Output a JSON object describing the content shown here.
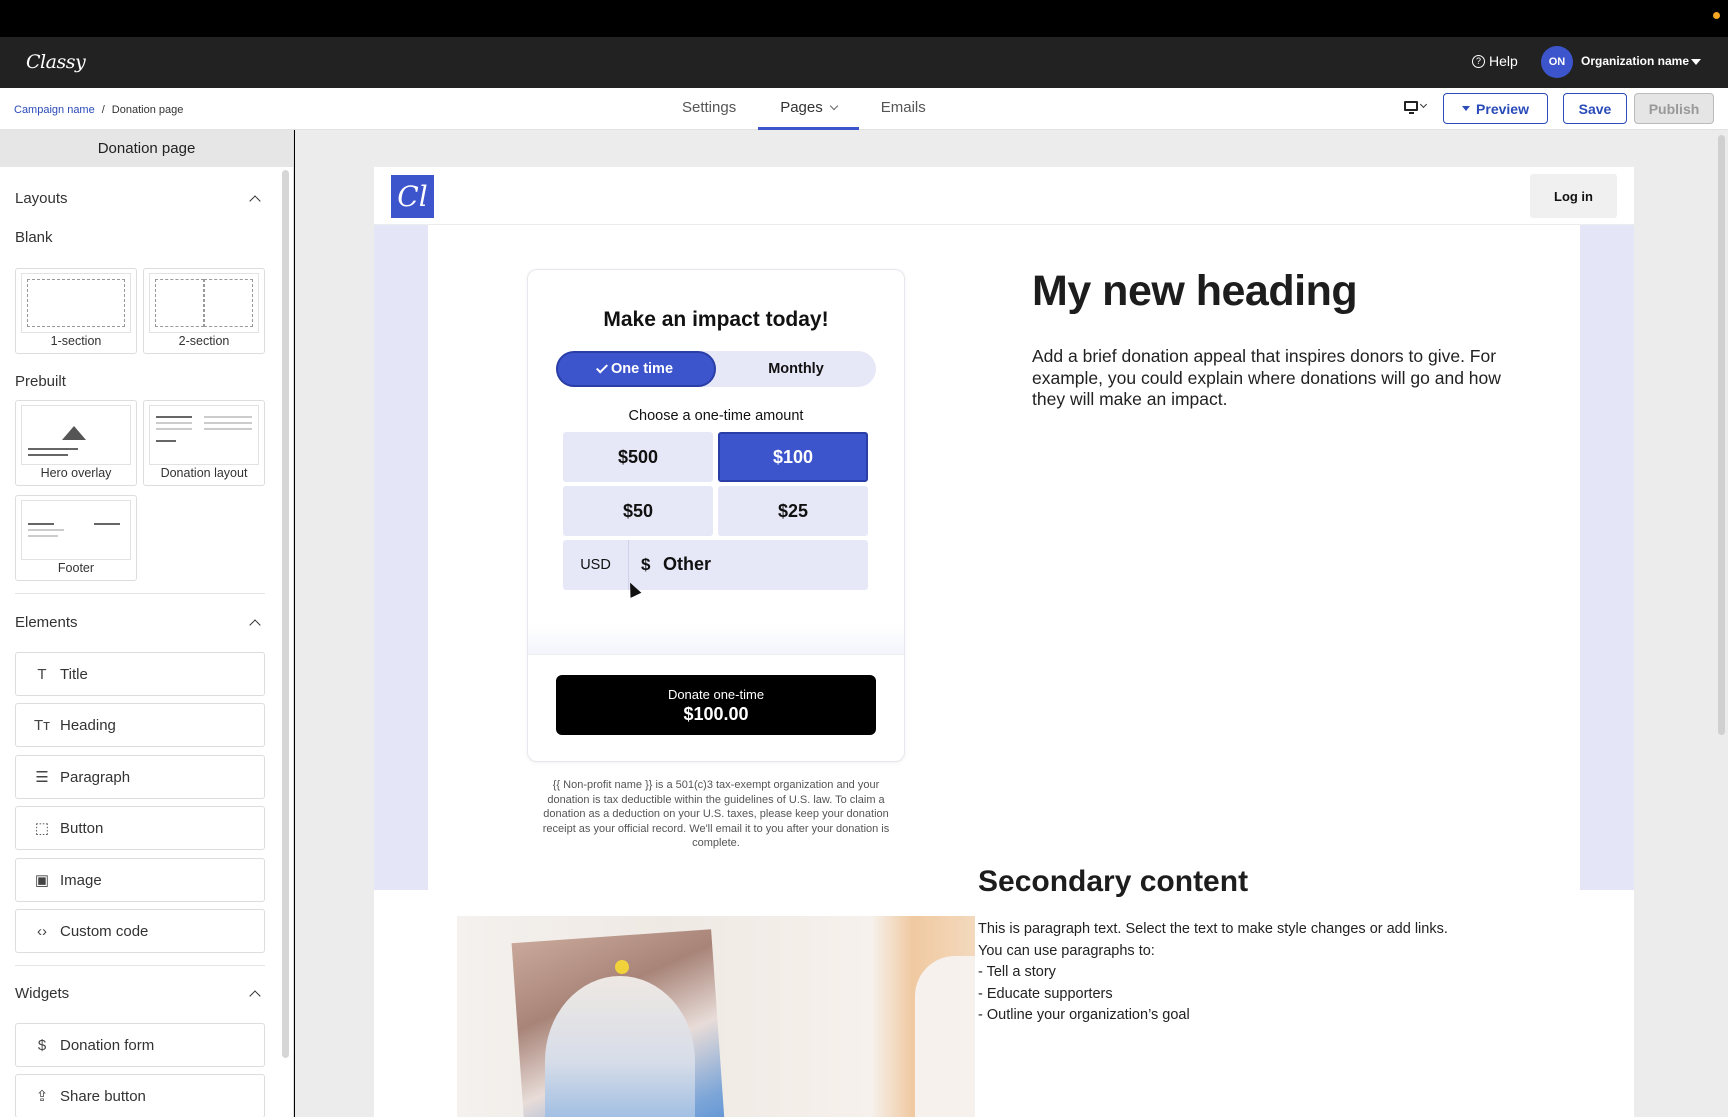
{
  "appbar": {
    "logo": "Classy",
    "help": "Help",
    "avatar_initials": "ON",
    "org_name": "Organization name"
  },
  "breadcrumb": {
    "campaign": "Campaign name",
    "separator": "/",
    "page": "Donation page"
  },
  "tabs": [
    {
      "label": "Settings"
    },
    {
      "label": "Pages"
    },
    {
      "label": "Emails"
    }
  ],
  "actions": {
    "preview": "Preview",
    "save": "Save",
    "publish": "Publish"
  },
  "sidebar": {
    "title": "Donation page",
    "layouts": {
      "title": "Layouts",
      "blank": "Blank",
      "blank_items": [
        "1-section",
        "2-section"
      ],
      "prebuilt": "Prebuilt",
      "prebuilt_items": [
        "Hero overlay",
        "Donation layout",
        "Footer"
      ]
    },
    "elements": {
      "title": "Elements",
      "items": [
        {
          "label": "Title",
          "icon": "title-icon"
        },
        {
          "label": "Heading",
          "icon": "heading-icon"
        },
        {
          "label": "Paragraph",
          "icon": "paragraph-icon"
        },
        {
          "label": "Button",
          "icon": "button-icon"
        },
        {
          "label": "Image",
          "icon": "image-icon"
        },
        {
          "label": "Custom code",
          "icon": "code-icon"
        }
      ]
    },
    "widgets": {
      "title": "Widgets",
      "items": [
        {
          "label": "Donation form",
          "icon": "donation-form-icon"
        },
        {
          "label": "Share button",
          "icon": "share-icon"
        }
      ]
    }
  },
  "page": {
    "logo": "Cl",
    "login": "Log in",
    "form": {
      "title": "Make an impact today!",
      "frequency": [
        "One time",
        "Monthly"
      ],
      "selected_frequency": "One time",
      "choose": "Choose a one-time amount",
      "amounts": [
        "$500",
        "$100",
        "$50",
        "$25"
      ],
      "selected_amount": "$100",
      "currency": "USD",
      "currency_symbol": "$",
      "other": "Other",
      "donate_line1": "Donate one-time",
      "donate_line2": "$100.00"
    },
    "tax_note": "{{ Non-profit name }} is a 501(c)3 tax-exempt organization and your donation is tax deductible within the guidelines of U.S. law. To claim a donation as a deduction on your U.S. taxes, please keep your donation receipt as your official record. We'll email it to you after your donation is complete.",
    "hero_heading": "My new heading",
    "hero_paragraph": "Add a brief donation appeal that inspires donors to give. For example, you could explain where donations will go and how they will make an impact.",
    "secondary_heading": "Secondary content",
    "secondary_lines": [
      "This is paragraph text. Select the text to make style changes or add links.",
      "You can use paragraphs to:",
      "- Tell a story",
      "- Educate supporters",
      "- Outline your organization’s goal"
    ]
  },
  "colors": {
    "accent": "#3d55cc",
    "appbar": "#222222",
    "hero_band": "#e4e6f8"
  }
}
